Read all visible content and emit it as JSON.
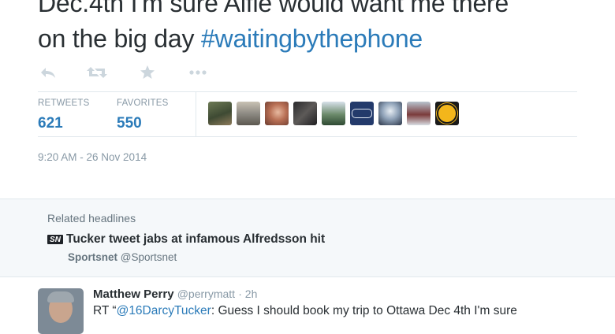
{
  "tweet": {
    "line1": "Dec.4th I'm sure Alfie would want me there",
    "line2": "on the big day ",
    "hashtag": "#waitingbythephone",
    "timestamp": "9:20 AM - 26 Nov 2014"
  },
  "actions": {
    "reply_icon": "reply-icon",
    "retweet_icon": "retweet-icon",
    "favorite_icon": "star-icon",
    "more_icon": "more-icon"
  },
  "stats": {
    "retweets_label": "RETWEETS",
    "retweets_value": "621",
    "favorites_label": "FAVORITES",
    "favorites_value": "550"
  },
  "related": {
    "label": "Related headlines",
    "headline": "Tucker tweet jabs at infamous Alfredsson hit",
    "source_name": "Sportsnet",
    "source_handle": "@Sportsnet",
    "logo_text": "SN"
  },
  "reply": {
    "name": "Matthew Perry",
    "handle": "@perrymatt",
    "time": "· 2h",
    "text_prefix": "RT “",
    "mention": "@16DarcyTucker",
    "text_rest": ": Guess I should book my trip to Ottawa Dec 4th I'm sure"
  },
  "colors": {
    "accent": "#2b7bb9",
    "muted": "#8899a6",
    "panel": "#f5f8fa"
  }
}
